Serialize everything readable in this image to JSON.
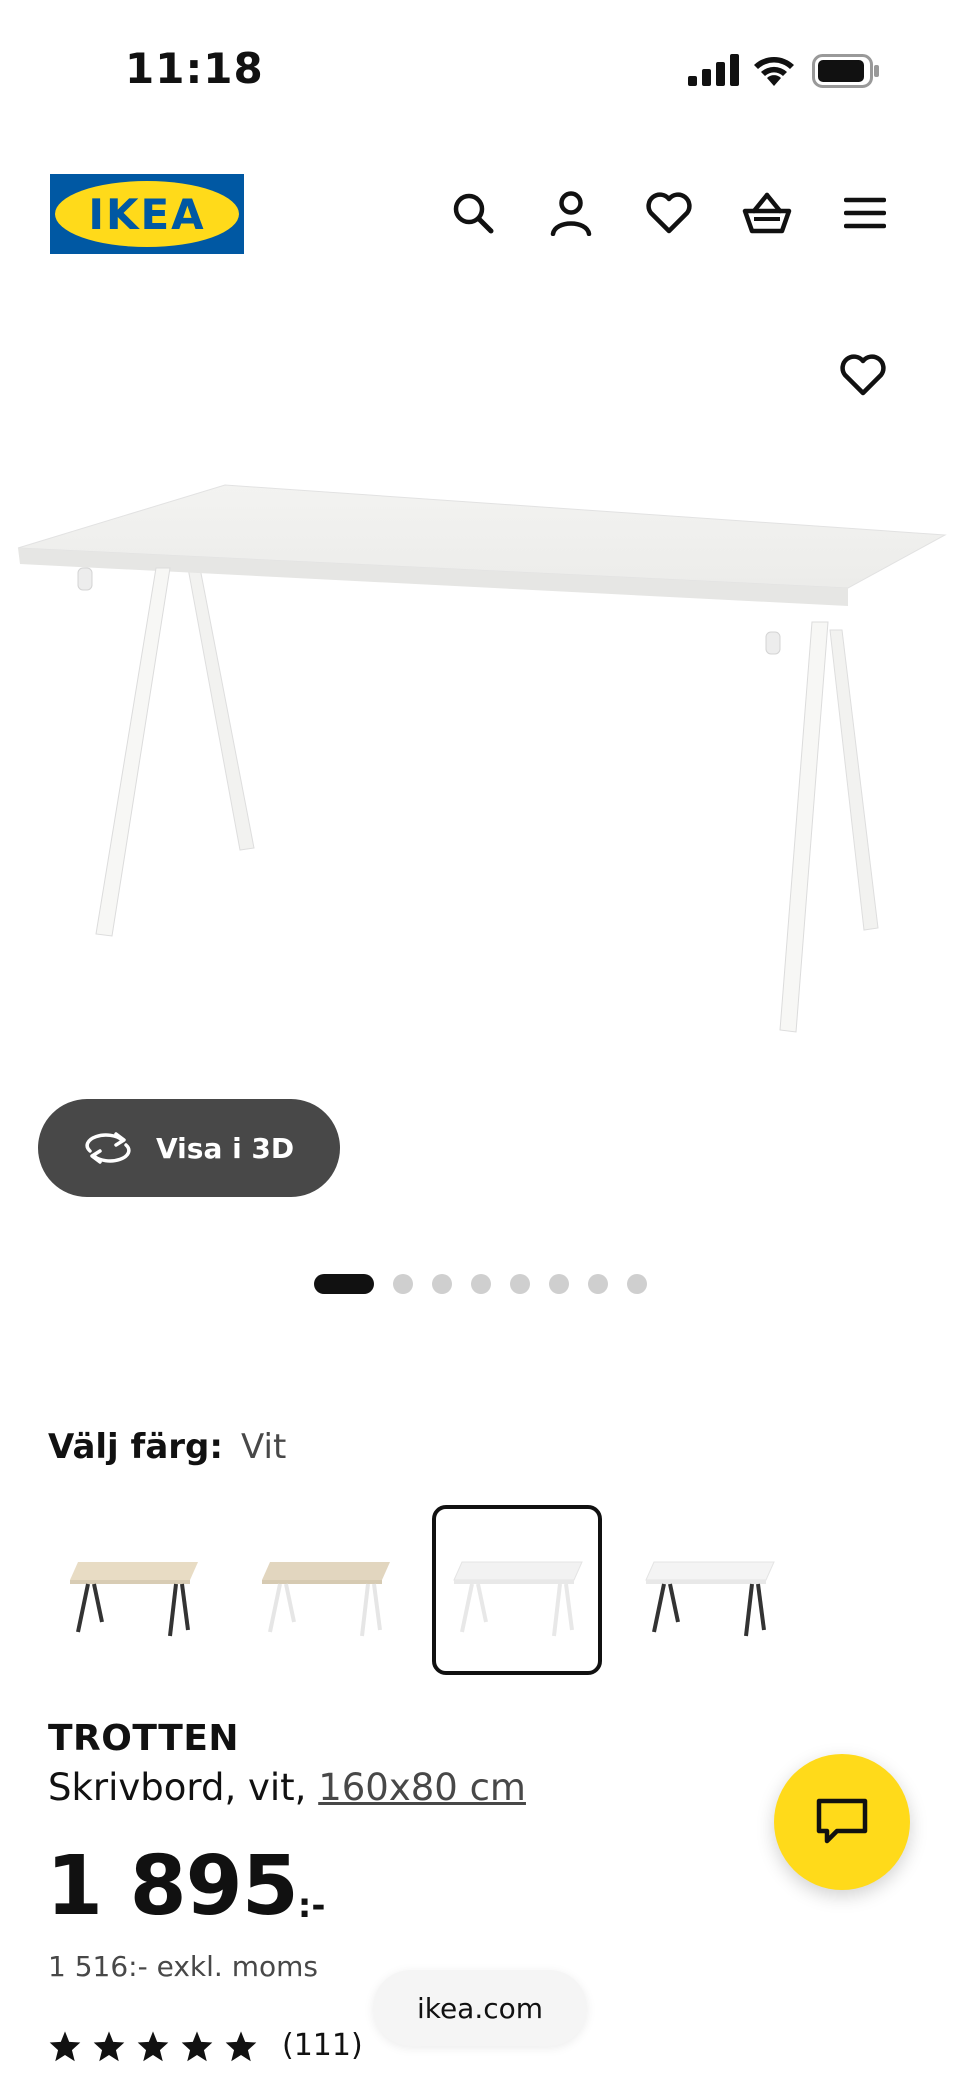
{
  "status_bar": {
    "time": "11:18"
  },
  "header": {
    "logo_text": "IKEA"
  },
  "product": {
    "view_3d_label": "Visa i 3D",
    "image_count": 8,
    "active_image_index": 0,
    "color_label": "Välj färg:",
    "color_value": "Vit",
    "swatches": [
      {
        "name": "beige-black",
        "top": "#e8dcc4",
        "legs": "#333333",
        "selected": false
      },
      {
        "name": "beige-white",
        "top": "#e2d6bf",
        "legs": "#eeeeee",
        "selected": false
      },
      {
        "name": "white",
        "top": "#f4f4f4",
        "legs": "#eeeeee",
        "selected": true
      },
      {
        "name": "white-black",
        "top": "#f6f6f6",
        "legs": "#333333",
        "selected": false
      }
    ],
    "name": "TROTTEN",
    "desc_prefix": "Skrivbord, vit, ",
    "size": "160x80 cm",
    "price_main": "1 895",
    "price_suffix": ":-",
    "price_ex_vat": "1 516:- exkl. moms",
    "rating_stars": 5,
    "review_count": "(111)"
  },
  "browser": {
    "url": "ikea.com"
  },
  "colors": {
    "ikea_blue": "#0058A3",
    "ikea_yellow": "#FFDA1A",
    "chat_yellow": "#FFDA1A"
  }
}
